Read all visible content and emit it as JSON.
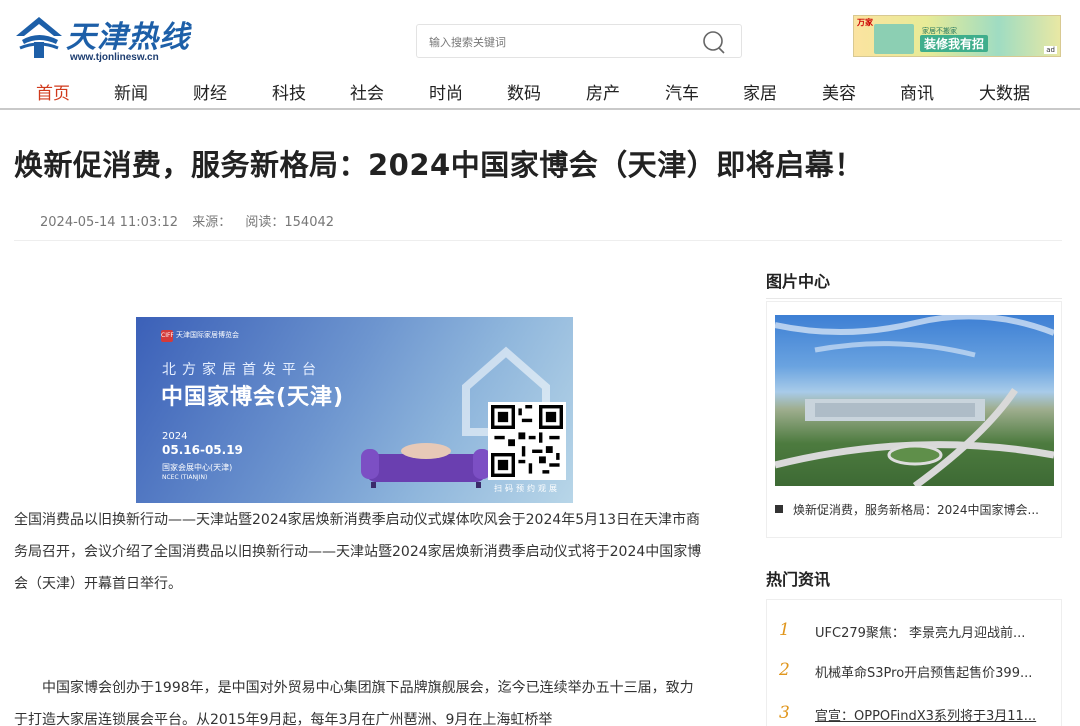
{
  "header": {
    "logo_text": "天津热线",
    "logo_url": "www.tjonlinesw.cn",
    "search_placeholder": "输入搜索关键词",
    "ad": {
      "tag": "万家",
      "small": "家居不搬家",
      "big": "装修我有招",
      "logo": "ad"
    }
  },
  "nav": {
    "items": [
      {
        "label": "首页",
        "active": true
      },
      {
        "label": "新闻"
      },
      {
        "label": "财经"
      },
      {
        "label": "科技"
      },
      {
        "label": "社会"
      },
      {
        "label": "时尚"
      },
      {
        "label": "数码"
      },
      {
        "label": "房产"
      },
      {
        "label": "汽车"
      },
      {
        "label": "家居"
      },
      {
        "label": "美容"
      },
      {
        "label": "商讯"
      },
      {
        "label": "大数据"
      }
    ]
  },
  "article": {
    "title": "焕新促消费，服务新格局：2024中国家博会（天津）即将启幕！",
    "date": "2024-05-14 11:03:12",
    "source": "来源：",
    "reads": "阅读：154042",
    "image": {
      "logo": "CIFF",
      "org": "天津国际家居博览会",
      "sub": "北方家居首发平台",
      "title": "中国家博会(天津)",
      "year": "2024",
      "dates": "05.16-05.19",
      "venue": "国家会展中心(天津)",
      "venue_en": "NCEC (TIANJIN)",
      "qr_caption": "扫码预约观展"
    },
    "para1": "全国消费品以旧换新行动——天津站暨2024家居焕新消费季启动仪式媒体吹风会于2024年5月13日在天津市商务局召开，会议介绍了全国消费品以旧换新行动——天津站暨2024家居焕新消费季启动仪式将于2024中国家博会（天津）开幕首日举行。",
    "para2": "中国家博会创办于1998年，是中国对外贸易中心集团旗下品牌旗舰展会，迄今已连续举办五十三届，致力于打造大家居连锁展会平台。从2015年9月起，每年3月在广州琶洲、9月在上海虹桥举"
  },
  "sidebar": {
    "pics_heading": "图片中心",
    "pic_caption": "焕新促消费，服务新格局：2024中国家博会...",
    "hot_heading": "热门资讯",
    "hot_items": [
      {
        "num": "1",
        "text": "UFC279聚焦： 李景亮九月迎战前..."
      },
      {
        "num": "2",
        "text": "机械革命S3Pro开启预售起售价399..."
      },
      {
        "num": "3",
        "text": "官宣：OPPOFindX3系列将于3月11..."
      }
    ]
  },
  "colors": {
    "brand": "#1d5fa8",
    "nav_active": "#d03a1c",
    "hot_number": "#e0961d"
  }
}
